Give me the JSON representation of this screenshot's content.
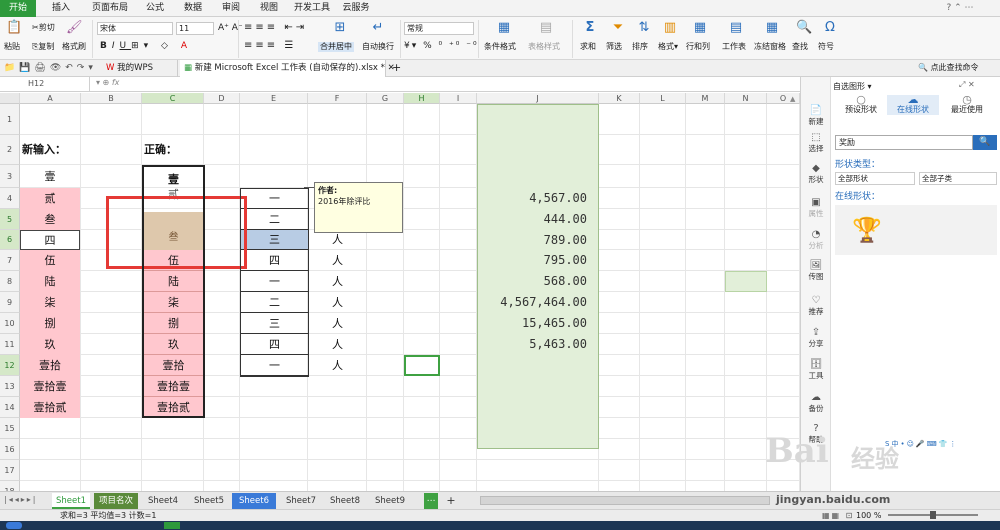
{
  "menu_tabs": [
    "开始",
    "插入",
    "页面布局",
    "公式",
    "数据",
    "审阅",
    "视图",
    "开发工具",
    "云服务"
  ],
  "ribbon": {
    "paste": "粘贴",
    "cut": "剪切",
    "copy": "复制",
    "format_painter": "格式刷",
    "font": "宋体",
    "size": "11",
    "merge": "合并居中",
    "wrap": "自动换行",
    "numfmt": "常规",
    "cond": "条件格式",
    "table_style": "表格样式",
    "sum": "求和",
    "filter": "筛选",
    "sort": "排序",
    "rowcol": "行和列",
    "sheet": "工作表",
    "freeze": "冻结窗格",
    "find": "查找",
    "symbol": "符号",
    "find_cmd": "点此查找命令"
  },
  "doc_tabs": {
    "wps": "我的WPS",
    "file": "新建 Microsoft Excel 工作表 (自动保存的).xlsx *"
  },
  "namebox": "H12",
  "fx": "fx",
  "columns": [
    "A",
    "B",
    "C",
    "D",
    "E",
    "F",
    "G",
    "H",
    "I",
    "J",
    "K",
    "L",
    "M",
    "N",
    "O"
  ],
  "rows": [
    "1",
    "2",
    "3",
    "4",
    "5",
    "6",
    "7",
    "8",
    "9",
    "10",
    "11",
    "12",
    "13",
    "14",
    "15",
    "16",
    "17",
    "18",
    "19"
  ],
  "headers": {
    "a2": "新输入：",
    "c2": "正确："
  },
  "colA": [
    "壹",
    "贰",
    "叁",
    "四",
    "伍",
    "陆",
    "柒",
    "捌",
    "玖",
    "壹拾",
    "壹拾壹",
    "壹拾贰"
  ],
  "colC": [
    "壹",
    "贰",
    "叁",
    "伍",
    "陆",
    "柒",
    "捌",
    "玖",
    "壹拾",
    "壹拾壹",
    "壹拾贰"
  ],
  "colE": [
    "一",
    "二",
    "三",
    "四",
    "一",
    "二",
    "三",
    "四",
    "一"
  ],
  "colF": [
    "人",
    "人",
    "人",
    "人",
    "人",
    "人",
    "人"
  ],
  "colJ": [
    "4,567.00",
    "444.00",
    "789.00",
    "795.00",
    "568.00",
    "4,567,464.00",
    "15,465.00",
    "5,463.00"
  ],
  "comment": {
    "author": "作者:",
    "text": "2016年除评比"
  },
  "sidebar": [
    "新建",
    "选择",
    "形状",
    "属性",
    "分析",
    "传图",
    "推荐",
    "分享",
    "工具",
    "备份",
    "帮助"
  ],
  "pane": {
    "title": "自选图形",
    "tab1": "预设形状",
    "tab2": "在线形状",
    "tab3": "最近使用",
    "search": "奖励",
    "type_label": "形状类型：",
    "sel1": "全部形状",
    "sel2": "全部子类",
    "online_label": "在线形状："
  },
  "sheets": [
    "Sheet1",
    "项目名次",
    "Sheet4",
    "Sheet5",
    "Sheet6",
    "Sheet7",
    "Sheet8",
    "Sheet9"
  ],
  "status": {
    "text": "求和=3  平均值=3  计数=1",
    "zoom": "100 %"
  },
  "watermark": {
    "brand": "Bai",
    "brand2": "经验",
    "site": "jingyan.baidu.com"
  },
  "colors": {
    "accent": "#2e9a3c",
    "pink": "#ffc7ce",
    "tan": "#dec8ac",
    "highlight": "#b8cce4",
    "green_fill": "#e2efd9",
    "red_box": "#e53935"
  }
}
